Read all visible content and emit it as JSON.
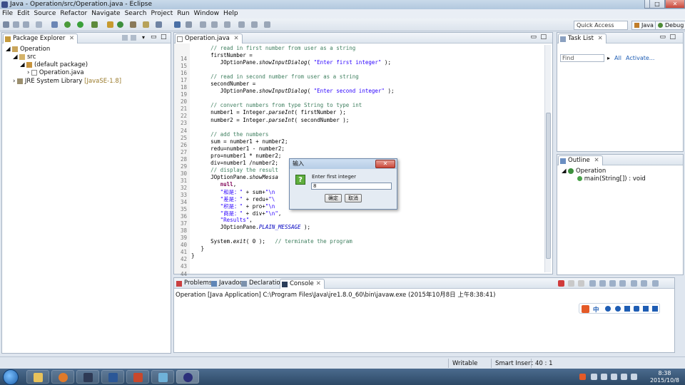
{
  "window": {
    "title": "Java - Operation/src/Operation.java - Eclipse"
  },
  "menu": [
    "File",
    "Edit",
    "Source",
    "Refactor",
    "Navigate",
    "Search",
    "Project",
    "Run",
    "Window",
    "Help"
  ],
  "quick_access": "Quick Access",
  "perspectives": [
    "Java",
    "Debug"
  ],
  "package_explorer": {
    "tab": "Package Explorer",
    "tree": [
      "Operation",
      "src",
      "(default package)",
      "Operation.java",
      "JRE System Library",
      "[JavaSE-1.8]"
    ]
  },
  "editor": {
    "tab": "Operation.java",
    "line_numbers": [
      "14",
      "15",
      "16",
      "17",
      "18",
      "19",
      "20",
      "21",
      "22",
      "23",
      "24",
      "25",
      "26",
      "27",
      "28",
      "29",
      "30",
      "31",
      "32",
      "33",
      "34",
      "35",
      "36",
      "37",
      "38",
      "39",
      "40",
      "41",
      "42",
      "43",
      "44"
    ],
    "lines": [
      {
        "parts": [
          {
            "c": "cmt",
            "t": "      // read in first number from user as a string"
          }
        ]
      },
      {
        "parts": [
          {
            "c": "",
            "t": "      firstNumber ="
          }
        ]
      },
      {
        "parts": [
          {
            "c": "",
            "t": "         JOptionPane."
          },
          {
            "c": "ital",
            "t": "showInputDialog"
          },
          {
            "c": "",
            "t": "( "
          },
          {
            "c": "str",
            "t": "\"Enter first integer\""
          },
          {
            "c": "",
            "t": " );"
          }
        ]
      },
      {
        "parts": [
          {
            "c": "",
            "t": ""
          }
        ]
      },
      {
        "parts": [
          {
            "c": "cmt",
            "t": "      // read in second number from user as a string"
          }
        ]
      },
      {
        "parts": [
          {
            "c": "",
            "t": "      secondNumber ="
          }
        ]
      },
      {
        "parts": [
          {
            "c": "",
            "t": "         JOptionPane."
          },
          {
            "c": "ital",
            "t": "showInputDialog"
          },
          {
            "c": "",
            "t": "( "
          },
          {
            "c": "str",
            "t": "\"Enter second integer\""
          },
          {
            "c": "",
            "t": " );"
          }
        ]
      },
      {
        "parts": [
          {
            "c": "",
            "t": ""
          }
        ]
      },
      {
        "parts": [
          {
            "c": "cmt",
            "t": "      // convert numbers from type String to type int"
          }
        ]
      },
      {
        "parts": [
          {
            "c": "",
            "t": "      number1 = Integer."
          },
          {
            "c": "ital",
            "t": "parseInt"
          },
          {
            "c": "",
            "t": "( firstNumber );"
          }
        ]
      },
      {
        "parts": [
          {
            "c": "",
            "t": "      number2 = Integer."
          },
          {
            "c": "ital",
            "t": "parseInt"
          },
          {
            "c": "",
            "t": "( secondNumber );"
          }
        ]
      },
      {
        "parts": [
          {
            "c": "",
            "t": ""
          }
        ]
      },
      {
        "parts": [
          {
            "c": "cmt",
            "t": "      // add the numbers"
          }
        ]
      },
      {
        "parts": [
          {
            "c": "",
            "t": "      sum = number1 + number2;"
          }
        ]
      },
      {
        "parts": [
          {
            "c": "",
            "t": "      redu=number1 - number2;"
          }
        ]
      },
      {
        "parts": [
          {
            "c": "",
            "t": "      pro=number1 * number2;"
          }
        ]
      },
      {
        "parts": [
          {
            "c": "",
            "t": "      div=number1 /number2;"
          }
        ]
      },
      {
        "parts": [
          {
            "c": "cmt",
            "t": "      // display the result"
          }
        ]
      },
      {
        "parts": [
          {
            "c": "",
            "t": "      JOptionPane."
          },
          {
            "c": "ital",
            "t": "showMessa"
          }
        ]
      },
      {
        "parts": [
          {
            "c": "kw",
            "t": "         null"
          },
          {
            "c": "",
            "t": ","
          }
        ]
      },
      {
        "parts": [
          {
            "c": "str",
            "t": "         \"和是：\""
          },
          {
            "c": "",
            "t": " + sum+"
          },
          {
            "c": "str",
            "t": "\"\\n"
          }
        ]
      },
      {
        "parts": [
          {
            "c": "str",
            "t": "         \"差是：\""
          },
          {
            "c": "",
            "t": " + redu+"
          },
          {
            "c": "str",
            "t": "\"\\"
          }
        ]
      },
      {
        "parts": [
          {
            "c": "str",
            "t": "         \"积是：\""
          },
          {
            "c": "",
            "t": " + pro+"
          },
          {
            "c": "str",
            "t": "\"\\n"
          }
        ]
      },
      {
        "parts": [
          {
            "c": "str",
            "t": "         \"商是：\""
          },
          {
            "c": "",
            "t": " + div+"
          },
          {
            "c": "str",
            "t": "\"\\n\""
          },
          {
            "c": "",
            "t": ","
          }
        ]
      },
      {
        "parts": [
          {
            "c": "str",
            "t": "         \"Results\""
          },
          {
            "c": "",
            "t": ","
          }
        ]
      },
      {
        "parts": [
          {
            "c": "",
            "t": "         JOptionPane."
          },
          {
            "c": "fld",
            "t": "PLAIN_MESSAGE"
          },
          {
            "c": "",
            "t": " );"
          }
        ]
      },
      {
        "parts": [
          {
            "c": "",
            "t": ""
          }
        ]
      },
      {
        "parts": [
          {
            "c": "",
            "t": "      System."
          },
          {
            "c": "ital",
            "t": "exit"
          },
          {
            "c": "",
            "t": "( 0 );   "
          },
          {
            "c": "cmt",
            "t": "// terminate the program"
          }
        ]
      },
      {
        "parts": [
          {
            "c": "",
            "t": "   }"
          }
        ]
      },
      {
        "parts": [
          {
            "c": "",
            "t": "}"
          }
        ]
      },
      {
        "parts": [
          {
            "c": "",
            "t": ""
          }
        ]
      }
    ]
  },
  "task_list": {
    "tab": "Task List",
    "find_placeholder": "Find",
    "all": "All",
    "activate": "Activate..."
  },
  "outline": {
    "tab": "Outline",
    "class": "Operation",
    "method": "main(String[]) : void"
  },
  "bottom_tabs": [
    "Problems",
    "Javadoc",
    "Declaration",
    "Console"
  ],
  "console": {
    "output": "Operation [Java Application] C:\\Program Files\\Java\\jre1.8.0_60\\bin\\javaw.exe (2015年10月8日 上午8:38:41)"
  },
  "dialog": {
    "title": "输入",
    "message": "Enter first integer",
    "input_value": "8",
    "ok": "确定",
    "cancel": "取消"
  },
  "ime_bar": {
    "label": "中"
  },
  "status": {
    "writable": "Writable",
    "insert": "Smart Insert",
    "position": "40 : 1"
  },
  "clock": {
    "time": "8:38",
    "date": "2015/10/8"
  },
  "colors": {
    "accent": "#3b6ea8",
    "comment": "#3f7f5f",
    "string": "#2a00ff",
    "keyword": "#7f0055"
  }
}
